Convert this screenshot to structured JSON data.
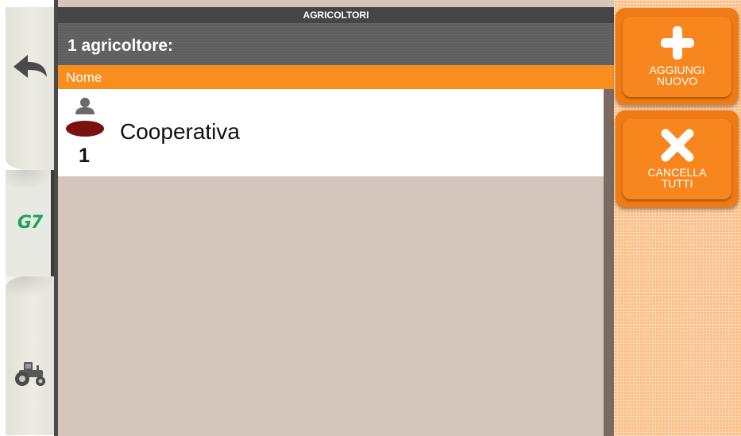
{
  "title": "AGRICOLTORI",
  "count_label": "1 agricoltore:",
  "column_header": "Nome",
  "farmers": [
    {
      "number": "1",
      "name": "Cooperativa"
    }
  ],
  "actions": {
    "add_label": "AGGIUNGI\nNUOVO",
    "delete_all_label": "CANCELLA\nTUTTI"
  },
  "sidebar": {
    "logo_text": "G7",
    "items": [
      "back-arrow-icon",
      "g7-logo",
      "tractor-icon"
    ]
  },
  "colors": {
    "accent_orange": "#f78e1e",
    "header_gray": "#454545",
    "list_bg": "#d4c6bc",
    "logo_green": "#1fa35a",
    "farmer_icon_red": "#7a1010"
  }
}
